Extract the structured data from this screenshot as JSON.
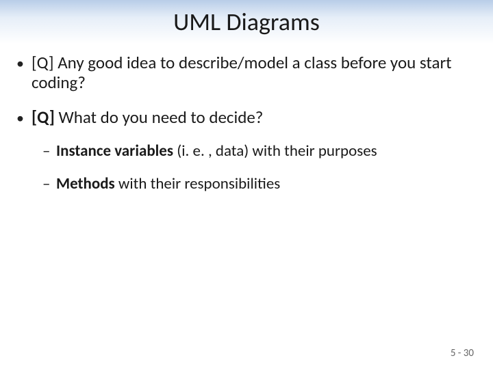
{
  "title": "UML Diagrams",
  "bullets": {
    "b1": {
      "q": "[Q]",
      "rest": " Any good idea to describe/model a class before you start coding?"
    },
    "b2": {
      "q": "[Q]",
      "rest": " What do you need to decide?"
    },
    "s1": {
      "bold": "Instance variables",
      "rest": " (i. e. , data) with their purposes"
    },
    "s2": {
      "bold": "Methods",
      "rest": " with their responsibilities"
    }
  },
  "footer": "5 - 30"
}
